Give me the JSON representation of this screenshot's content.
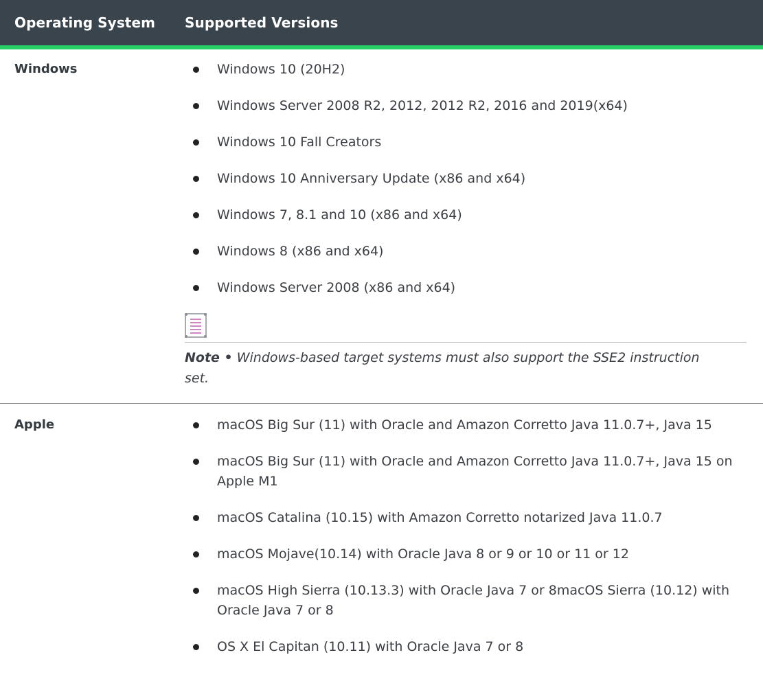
{
  "header": {
    "col_os": "Operating System",
    "col_versions": "Supported Versions"
  },
  "rows": [
    {
      "os": "Windows",
      "versions": [
        "Windows 10 (20H2)",
        "Windows Server 2008 R2, 2012, 2012 R2, 2016 and 2019(x64)",
        "Windows 10 Fall Creators",
        "Windows 10 Anniversary Update (x86 and x64)",
        "Windows 7, 8.1 and 10 (x86 and x64)",
        "Windows 8 (x86 and x64)",
        "Windows Server 2008 (x86 and x64)"
      ],
      "note": {
        "icon": "note-document-icon",
        "label": "Note •",
        "text": "Windows-based target systems must also support the SSE2 instruction set."
      }
    },
    {
      "os": "Apple",
      "versions": [
        "macOS Big Sur (11) with Oracle and Amazon Corretto Java 11.0.7+, Java 15",
        "macOS Big Sur (11) with Oracle and Amazon Corretto Java 11.0.7+, Java 15 on Apple M1",
        "macOS Catalina (10.15) with Amazon Corretto notarized Java 11.0.7",
        "macOS Mojave(10.14) with Oracle Java 8 or 9 or 10 or 11 or 12",
        "macOS High Sierra (10.13.3) with Oracle Java 7 or 8macOS Sierra (10.12) with Oracle Java 7 or 8",
        "OS X El Capitan (10.11) with Oracle Java 7 or 8"
      ]
    }
  ],
  "colors": {
    "header_bg": "#39444d",
    "header_accent": "#27d166",
    "text": "#3b3f45"
  }
}
